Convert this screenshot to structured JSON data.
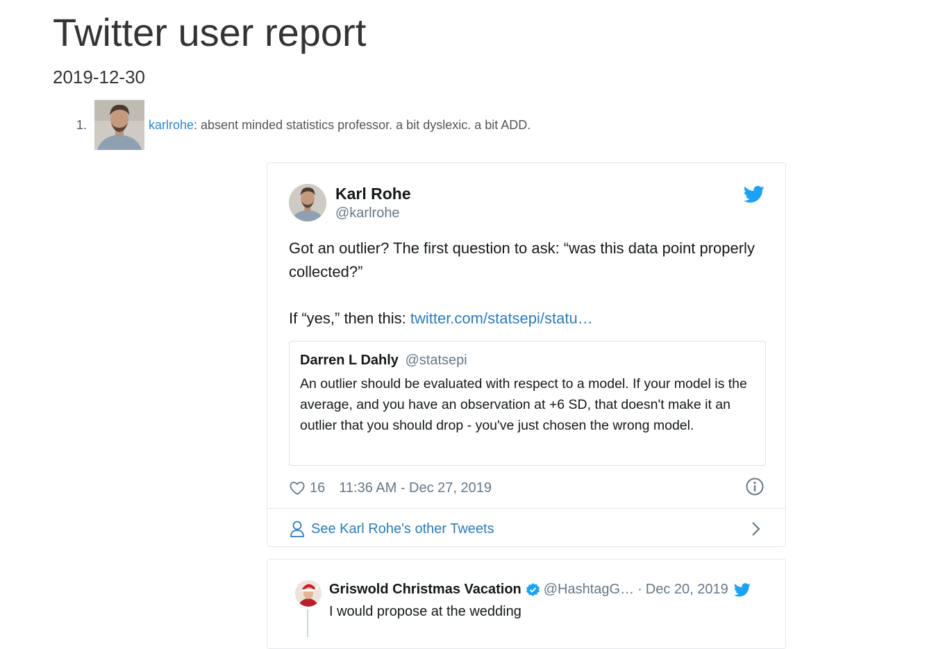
{
  "report": {
    "title": "Twitter user report",
    "date": "2019-12-30"
  },
  "users": [
    {
      "number": "1.",
      "username": "karlrohe",
      "description": ": absent minded statistics professor. a bit dyslexic. a bit ADD."
    }
  ],
  "tweet1": {
    "display_name": "Karl Rohe",
    "handle": "@karlrohe",
    "text_line1": "Got an outlier? The first question to ask: “was this data point properly collected?”",
    "text_line2_prefix": "If “yes,” then this: ",
    "text_link": "twitter.com/statsepi/statu…",
    "quote": {
      "name": "Darren L Dahly",
      "handle": "@statsepi",
      "text": "An outlier should be evaluated with respect to a model. If your model is the average, and you have an observation at +6 SD, that doesn't make it an outlier that you should drop - you've just chosen the wrong model."
    },
    "likes": "16",
    "timestamp": "11:36 AM - Dec 27, 2019",
    "see_more": "See Karl Rohe's other Tweets"
  },
  "tweet2": {
    "display_name": "Griswold Christmas Vacation",
    "handle": "@HashtagG…",
    "separator": "·",
    "date": "Dec 20, 2019",
    "text": "I would propose at the wedding"
  },
  "colors": {
    "link": "#2a88d2",
    "twitter_blue": "#1da1f2",
    "muted": "#657786"
  },
  "icons": [
    "twitter-bird-icon",
    "heart-icon",
    "info-icon",
    "person-icon",
    "chevron-right-icon",
    "verified-icon"
  ]
}
